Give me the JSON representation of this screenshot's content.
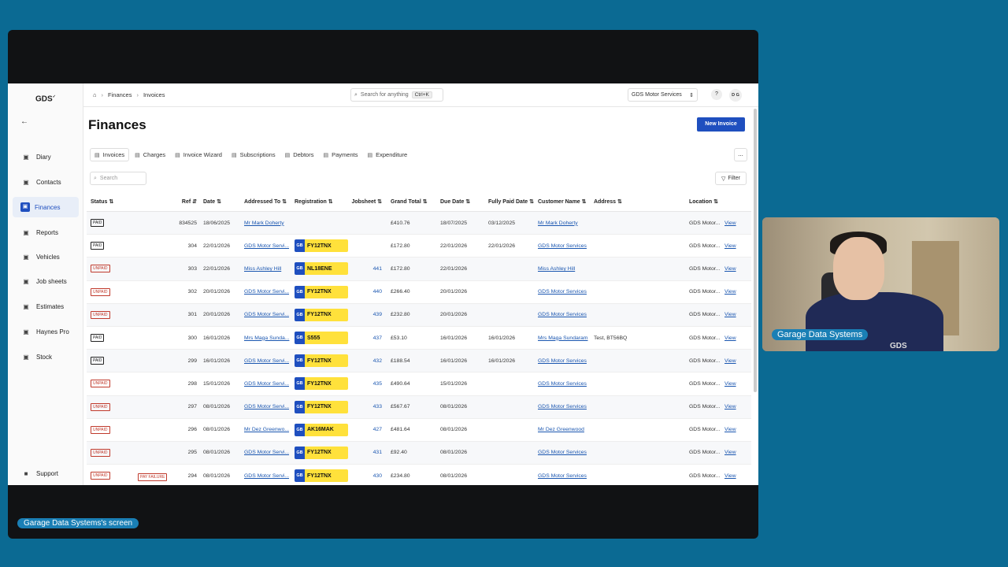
{
  "share_label": "Garage Data Systems's screen",
  "camera_label": "Garage Data Systems",
  "camera_logo": "GDS",
  "sidebar": {
    "logo": "GDS",
    "items": [
      {
        "label": "Diary",
        "icon": "calendar-icon"
      },
      {
        "label": "Contacts",
        "icon": "contacts-icon"
      },
      {
        "label": "Finances",
        "icon": "finances-icon"
      },
      {
        "label": "Reports",
        "icon": "reports-icon"
      },
      {
        "label": "Vehicles",
        "icon": "car-icon"
      },
      {
        "label": "Job sheets",
        "icon": "document-icon"
      },
      {
        "label": "Estimates",
        "icon": "estimate-icon"
      },
      {
        "label": "Haynes Pro",
        "icon": "haynes-icon"
      },
      {
        "label": "Stock",
        "icon": "stock-icon"
      }
    ],
    "support": "Support"
  },
  "topbar": {
    "breadcrumb": [
      "Finances",
      "Invoices"
    ],
    "search_placeholder": "Search for anything",
    "shortcut": "Ctrl+K",
    "org": "GDS Motor Services",
    "avatar": "D G"
  },
  "page": {
    "title": "Finances",
    "new_invoice": "New Invoice",
    "tabs": [
      "Invoices",
      "Charges",
      "Invoice Wizard",
      "Subscriptions",
      "Debtors",
      "Payments",
      "Expenditure"
    ],
    "more": "...",
    "search_placeholder": "Search",
    "filter": "Filter"
  },
  "table": {
    "headers": {
      "status": "Status ⇅",
      "ref": "Ref ⇵",
      "date": "Date ⇅",
      "addressed_to": "Addressed To ⇅",
      "registration": "Registration ⇅",
      "jobsheet": "Jobsheet ⇅",
      "grand_total": "Grand Total ⇅",
      "due_date": "Due Date ⇅",
      "fully_paid": "Fully Paid Date ⇅",
      "customer": "Customer Name ⇅",
      "address": "Address ⇅",
      "location": "Location ⇅"
    },
    "view_label": "View",
    "rows": [
      {
        "status": "PAID",
        "ref": "834525",
        "date": "18/06/2025",
        "addressed_to": "Mr Mark Doherty",
        "reg": "",
        "jobsheet": "",
        "total": "£410.76",
        "due": "18/07/2025",
        "paid_date": "03/12/2025",
        "customer": "Mr Mark Doherty",
        "address": "",
        "location": "GDS Motor..."
      },
      {
        "status": "PAID",
        "ref": "304",
        "date": "22/01/2026",
        "addressed_to": "GDS Motor Servi...",
        "reg": "FY12TNX",
        "jobsheet": "",
        "total": "£172.80",
        "due": "22/01/2026",
        "paid_date": "22/01/2026",
        "customer": "GDS Motor Services",
        "address": "",
        "location": "GDS Motor..."
      },
      {
        "status": "UNPAID",
        "ref": "303",
        "date": "22/01/2026",
        "addressed_to": "Miss Ashley Hill",
        "reg": "NL18ENE",
        "jobsheet": "441",
        "total": "£172.80",
        "due": "22/01/2026",
        "paid_date": "",
        "customer": "Miss Ashley Hill",
        "address": "",
        "location": "GDS Motor..."
      },
      {
        "status": "UNPAID",
        "ref": "302",
        "date": "20/01/2026",
        "addressed_to": "GDS Motor Servi...",
        "reg": "FY12TNX",
        "jobsheet": "440",
        "total": "£266.40",
        "due": "20/01/2026",
        "paid_date": "",
        "customer": "GDS Motor Services",
        "address": "",
        "location": "GDS Motor..."
      },
      {
        "status": "UNPAID",
        "ref": "301",
        "date": "20/01/2026",
        "addressed_to": "GDS Motor Servi...",
        "reg": "FY12TNX",
        "jobsheet": "439",
        "total": "£232.80",
        "due": "20/01/2026",
        "paid_date": "",
        "customer": "GDS Motor Services",
        "address": "",
        "location": "GDS Motor..."
      },
      {
        "status": "PAID",
        "ref": "300",
        "date": "16/01/2026",
        "addressed_to": "Mrs Maga Sunda...",
        "reg": "S555",
        "jobsheet": "437",
        "total": "£53.10",
        "due": "16/01/2026",
        "paid_date": "16/01/2026",
        "customer": "Mrs Maga Sundaram",
        "address": "Test, BT56BQ",
        "location": "GDS Motor..."
      },
      {
        "status": "PAID",
        "ref": "299",
        "date": "16/01/2026",
        "addressed_to": "GDS Motor Servi...",
        "reg": "FY12TNX",
        "jobsheet": "432",
        "total": "£188.54",
        "due": "16/01/2026",
        "paid_date": "16/01/2026",
        "customer": "GDS Motor Services",
        "address": "",
        "location": "GDS Motor..."
      },
      {
        "status": "UNPAID",
        "ref": "298",
        "date": "15/01/2026",
        "addressed_to": "GDS Motor Servi...",
        "reg": "FY12TNX",
        "jobsheet": "435",
        "total": "£490.64",
        "due": "15/01/2026",
        "paid_date": "",
        "customer": "GDS Motor Services",
        "address": "",
        "location": "GDS Motor..."
      },
      {
        "status": "UNPAID",
        "ref": "297",
        "date": "08/01/2026",
        "addressed_to": "GDS Motor Servi...",
        "reg": "FY12TNX",
        "jobsheet": "433",
        "total": "£567.67",
        "due": "08/01/2026",
        "paid_date": "",
        "customer": "GDS Motor Services",
        "address": "",
        "location": "GDS Motor..."
      },
      {
        "status": "UNPAID",
        "ref": "296",
        "date": "08/01/2026",
        "addressed_to": "Mr Dez Greenwo...",
        "reg": "AK16MAK",
        "jobsheet": "427",
        "total": "£481.64",
        "due": "08/01/2026",
        "paid_date": "",
        "customer": "Mr Dez Greenwood",
        "address": "",
        "location": "GDS Motor..."
      },
      {
        "status": "UNPAID",
        "ref": "295",
        "date": "08/01/2026",
        "addressed_to": "GDS Motor Servi...",
        "reg": "FY12TNX",
        "jobsheet": "431",
        "total": "£92.40",
        "due": "08/01/2026",
        "paid_date": "",
        "customer": "GDS Motor Services",
        "address": "",
        "location": "GDS Motor..."
      },
      {
        "status": "UNPAID",
        "extra": "PAY FAILURE",
        "ref": "294",
        "date": "08/01/2026",
        "addressed_to": "GDS Motor Servi...",
        "reg": "FY12TNX",
        "jobsheet": "430",
        "total": "£234.80",
        "due": "08/01/2026",
        "paid_date": "",
        "customer": "GDS Motor Services",
        "address": "",
        "location": "GDS Motor..."
      }
    ]
  },
  "colors": {
    "accent": "#1f4fbf",
    "plate": "#ffe13b",
    "unpaid": "#c0392b",
    "background": "#0b6a93"
  }
}
